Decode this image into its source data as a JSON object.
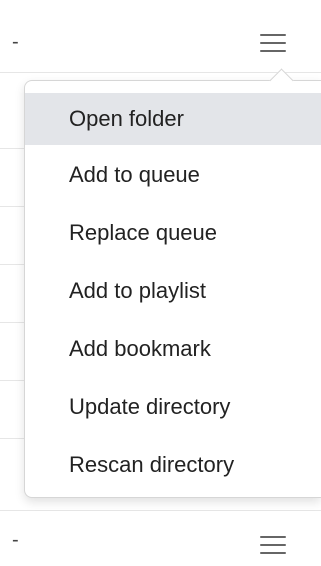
{
  "list": {
    "rows": [
      {
        "dash": "-"
      },
      {
        "dash": "-"
      }
    ]
  },
  "menu": {
    "items": [
      {
        "label": "Open folder",
        "active": true
      },
      {
        "label": "Add to queue",
        "active": false
      },
      {
        "label": "Replace queue",
        "active": false
      },
      {
        "label": "Add to playlist",
        "active": false
      },
      {
        "label": "Add bookmark",
        "active": false
      },
      {
        "label": "Update directory",
        "active": false
      },
      {
        "label": "Rescan directory",
        "active": false
      }
    ]
  },
  "colors": {
    "highlight": "#e3e5e9",
    "text": "#222222"
  },
  "icons": {
    "menu_toggle": "hamburger-icon"
  }
}
